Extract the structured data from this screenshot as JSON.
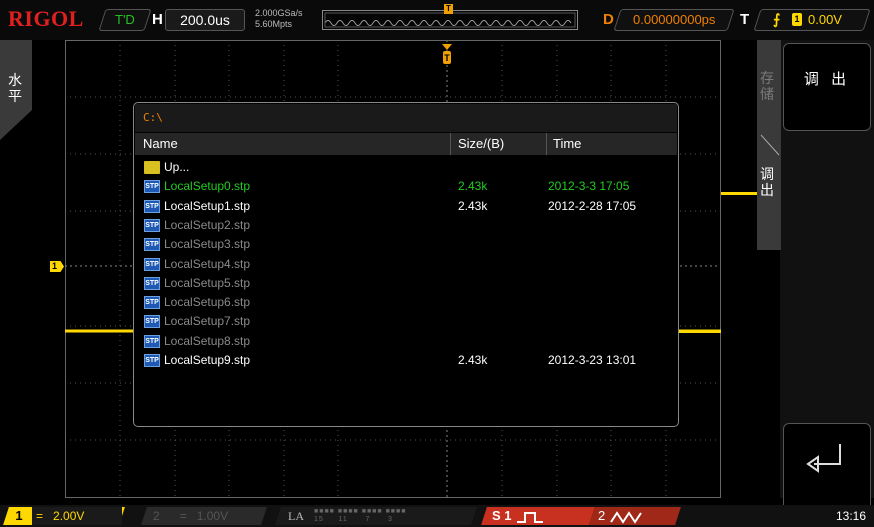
{
  "top": {
    "brand": "RIGOL",
    "run_state": "T'D",
    "h_label": "H",
    "timebase": "200.0us",
    "sample_rate": "2.000GSa/s",
    "memory_depth": "5.60Mpts",
    "delay_label": "D",
    "delay_value": "0.00000000ps",
    "trigger_label": "T",
    "trigger_source": "1",
    "trigger_level": "0.00V",
    "trigger_marker": "T"
  },
  "left_menu": {
    "label": "水平"
  },
  "right_menu": {
    "top_button": "调 出",
    "tab_storage": "存储",
    "tab_recall": "调出"
  },
  "dialog": {
    "path": "C:\\",
    "columns": {
      "name": "Name",
      "size": "Size/(B)",
      "time": "Time"
    },
    "files": [
      {
        "name": "Up...",
        "size": "",
        "time": "",
        "type": "folder",
        "state": "normal"
      },
      {
        "name": "LocalSetup0.stp",
        "size": "2.43k",
        "time": "2012-3-3 17:05",
        "type": "stp",
        "state": "selected"
      },
      {
        "name": "LocalSetup1.stp",
        "size": "2.43k",
        "time": "2012-2-28 17:05",
        "type": "stp",
        "state": "normal"
      },
      {
        "name": "LocalSetup2.stp",
        "size": "",
        "time": "",
        "type": "stp",
        "state": "empty"
      },
      {
        "name": "LocalSetup3.stp",
        "size": "",
        "time": "",
        "type": "stp",
        "state": "empty"
      },
      {
        "name": "LocalSetup4.stp",
        "size": "",
        "time": "",
        "type": "stp",
        "state": "empty"
      },
      {
        "name": "LocalSetup5.stp",
        "size": "",
        "time": "",
        "type": "stp",
        "state": "empty"
      },
      {
        "name": "LocalSetup6.stp",
        "size": "",
        "time": "",
        "type": "stp",
        "state": "empty"
      },
      {
        "name": "LocalSetup7.stp",
        "size": "",
        "time": "",
        "type": "stp",
        "state": "empty"
      },
      {
        "name": "LocalSetup8.stp",
        "size": "",
        "time": "",
        "type": "stp",
        "state": "empty"
      },
      {
        "name": "LocalSetup9.stp",
        "size": "2.43k",
        "time": "2012-3-23 13:01",
        "type": "stp",
        "state": "normal"
      }
    ],
    "icon_text": "STP"
  },
  "channel_marker": "1",
  "bottom": {
    "ch1_num": "1",
    "ch1_coupling": "=",
    "ch1_scale": "2.00V",
    "ch2_num": "2",
    "ch2_coupling": "=",
    "ch2_scale": "1.00V",
    "la_label": "LA",
    "la_channels": "15     11      7      3",
    "s1_label": "S 1",
    "s2_label": "2",
    "time": "13:16"
  },
  "colors": {
    "ch1": "#ffd800",
    "selected": "#22cc22",
    "empty": "#8a8a8a",
    "accent": "#f08000"
  }
}
